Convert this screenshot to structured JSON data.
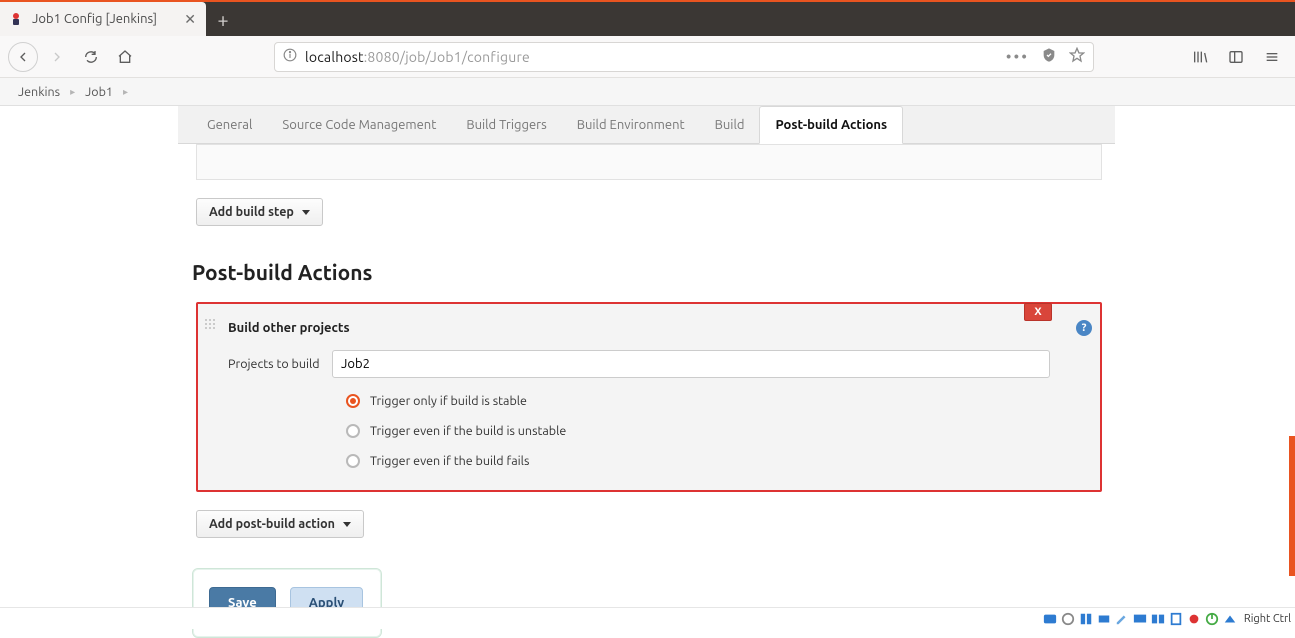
{
  "browser": {
    "tab_title": "Job1 Config [Jenkins]",
    "url_host": "localhost",
    "url_port_path": ":8080/job/Job1/configure"
  },
  "breadcrumb": {
    "root": "Jenkins",
    "item": "Job1"
  },
  "tabs": {
    "general": "General",
    "scm": "Source Code Management",
    "triggers": "Build Triggers",
    "env": "Build Environment",
    "build": "Build",
    "post": "Post-build Actions"
  },
  "buttons": {
    "add_build_step": "Add build step",
    "add_post_build": "Add post-build action",
    "save": "Save",
    "apply": "Apply",
    "delete_x": "X"
  },
  "section": {
    "post_build_title": "Post-build Actions"
  },
  "block": {
    "title": "Build other projects",
    "field_label": "Projects to build",
    "field_value": "Job2",
    "radio1": "Trigger only if build is stable",
    "radio2": "Trigger even if the build is unstable",
    "radio3": "Trigger even if the build fails",
    "help": "?"
  },
  "vm": {
    "right_ctrl": "Right Ctrl"
  }
}
